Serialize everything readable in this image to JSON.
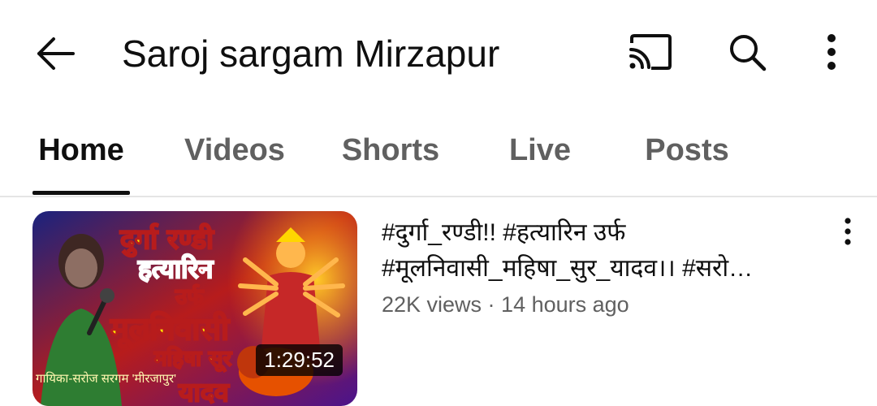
{
  "header": {
    "back_icon": "arrow-left-icon",
    "title": "Saroj sargam Mirzapur",
    "cast_icon": "cast-icon",
    "search_icon": "search-icon",
    "more_icon": "more-vert-icon"
  },
  "tabs": [
    {
      "label": "Home",
      "active": true
    },
    {
      "label": "Videos",
      "active": false
    },
    {
      "label": "Shorts",
      "active": false
    },
    {
      "label": "Live",
      "active": false
    },
    {
      "label": "Posts",
      "active": false
    }
  ],
  "video": {
    "title_line1": "#दुर्गा_रण्डी!! #हत्यारिन उर्फ",
    "title_line2": "#मूलनिवासी_महिषा_सुर_यादव।। #सरो…",
    "meta": "22K views · 14 hours ago",
    "duration": "1:29:52",
    "thumbnail_caption": "गायिका-सरोज सरगम 'मीरजापुर'",
    "thumbnail_text": [
      "दुर्गा रण्डी",
      "हत्यारिन",
      "उर्फ",
      "मूलनिवासी",
      "महिषा सूर",
      "यादव"
    ],
    "more_icon": "more-vert-icon"
  },
  "colors": {
    "text_primary": "#0f0f0f",
    "text_secondary": "#606060",
    "divider": "#e5e5e5",
    "thumb_red": "#d32f2f",
    "thumb_yellow": "#ffe600"
  }
}
